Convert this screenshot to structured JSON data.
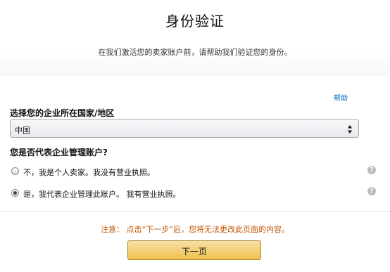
{
  "header": {
    "title": "身份验证",
    "subtitle": "在我们激活您的卖家账户前，请帮助我们验证您的身份。"
  },
  "help": {
    "label": "帮助"
  },
  "country": {
    "label": "选择您的企业所在国家/地区",
    "selected": "中国"
  },
  "manager": {
    "label": "您是否代表企业管理账户?",
    "options": [
      {
        "label": "不，我是个人卖家。我没有营业执照。",
        "checked": false
      },
      {
        "label": "是，我代表企业管理此账户。 我有营业执照。",
        "checked": true
      }
    ]
  },
  "notice": "注意： 点击“下一步”后，您将无法更改此页面的内容。",
  "next_button": {
    "label": "下一页"
  },
  "colors": {
    "link": "#0066c0",
    "notice": "#c45500",
    "button_top": "#f7dfa5",
    "button_bottom": "#f0c14b",
    "button_border": "#a88734"
  },
  "icons": {
    "help_tooltip": "question-circle-icon",
    "select_arrows": "sort-arrows-icon"
  }
}
